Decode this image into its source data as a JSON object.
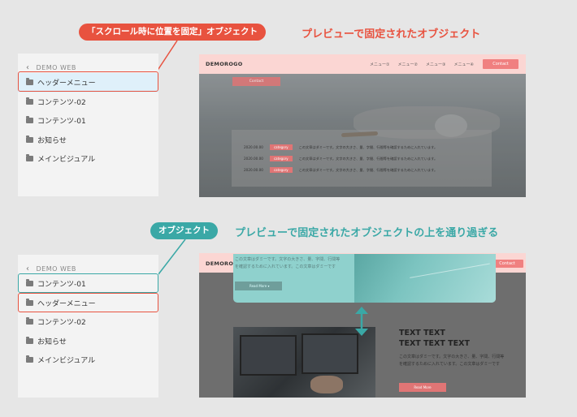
{
  "callouts": {
    "top_pill": "「スクロール時に位置を固定」オブジェクト",
    "top_caption": "プレビューで固定されたオブジェクト",
    "bottom_pill": "オブジェクト",
    "bottom_caption": "プレビューで固定されたオブジェクトの上を通り過ぎる",
    "colors": {
      "red": "#e8523f",
      "teal": "#3aa8a6"
    }
  },
  "panel1": {
    "back_label": "DEMO WEB",
    "items": [
      {
        "label": "ヘッダーメニュー"
      },
      {
        "label": "コンテンツ-02"
      },
      {
        "label": "コンテンツ-01"
      },
      {
        "label": "お知らせ"
      },
      {
        "label": "メインビジュアル"
      }
    ]
  },
  "panel2": {
    "back_label": "DEMO WEB",
    "items": [
      {
        "label": "コンテンツ-01"
      },
      {
        "label": "ヘッダーメニュー"
      },
      {
        "label": "コンテンツ-02"
      },
      {
        "label": "お知らせ"
      },
      {
        "label": "メインビジュアル"
      }
    ]
  },
  "preview1": {
    "logo": "DEMOROGO",
    "menu": [
      "メニュー①",
      "メニュー②",
      "メニュー③",
      "メニュー④"
    ],
    "contact": "Contact",
    "contact2": "Contact",
    "news": [
      {
        "date": "2020.00.00",
        "category": "category",
        "text": "この文章はダミーです。文字の大きさ、量、字間、行間等を確認するために入れています。"
      },
      {
        "date": "2020.00.00",
        "category": "category",
        "text": "この文章はダミーです。文字の大きさ、量、字間、行間等を確認するために入れています。"
      },
      {
        "date": "2020.00.00",
        "category": "category",
        "text": "この文章はダミーです。文字の大きさ、量、字間、行間等を確認するために入れています。"
      }
    ]
  },
  "preview2": {
    "logo": "DEMOROGO",
    "contact": "Contact",
    "object_text": "この文章はダミーです。文字の大きさ、量、字間、行間等を確認するために入れています。この文章はダミーです",
    "object_button": "Read More",
    "title_line1": "TEXT TEXT",
    "title_line2": "TEXT TEXT TEXT",
    "body": "この文章はダミーです。文字の大きさ、量、字間、行間等を確認するために入れています。この文章はダミーです",
    "read_more": "Read More"
  }
}
